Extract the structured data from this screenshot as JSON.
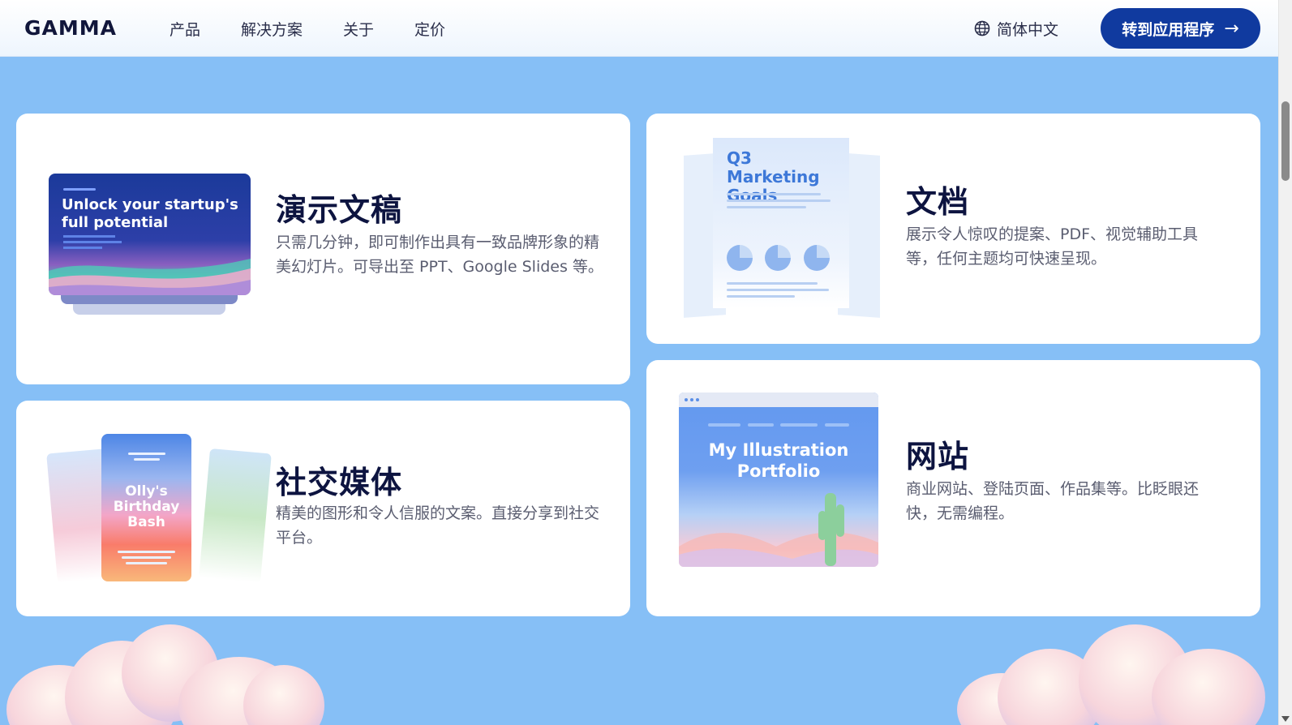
{
  "header": {
    "logo": "GAMMA",
    "nav": [
      "产品",
      "解决方案",
      "关于",
      "定价"
    ],
    "language": "简体中文",
    "cta_label": "转到应用程序",
    "cta_arrow": "→"
  },
  "cards": {
    "presentation": {
      "title": "演示文稿",
      "desc": "只需几分钟，即可制作出具有一致品牌形象的精美幻灯片。可导出至 PPT、Google Slides 等。",
      "thumb_text": "Unlock your startup's full potential"
    },
    "document": {
      "title": "文档",
      "desc": "展示令人惊叹的提案、PDF、视觉辅助工具等，任何主题均可快速呈现。",
      "thumb_text": "Q3 Marketing Goals"
    },
    "social": {
      "title": "社交媒体",
      "desc": "精美的图形和令人信服的文案。直接分享到社交平台。",
      "thumb_text": "Olly's Birthday Bash"
    },
    "website": {
      "title": "网站",
      "desc": "商业网站、登陆页面、作品集等。比眨眼还快，无需编程。",
      "thumb_text": "My Illustration Portfolio"
    }
  },
  "colors": {
    "background": "#86bff6",
    "cta": "#103a9f",
    "title": "#0d1440"
  }
}
